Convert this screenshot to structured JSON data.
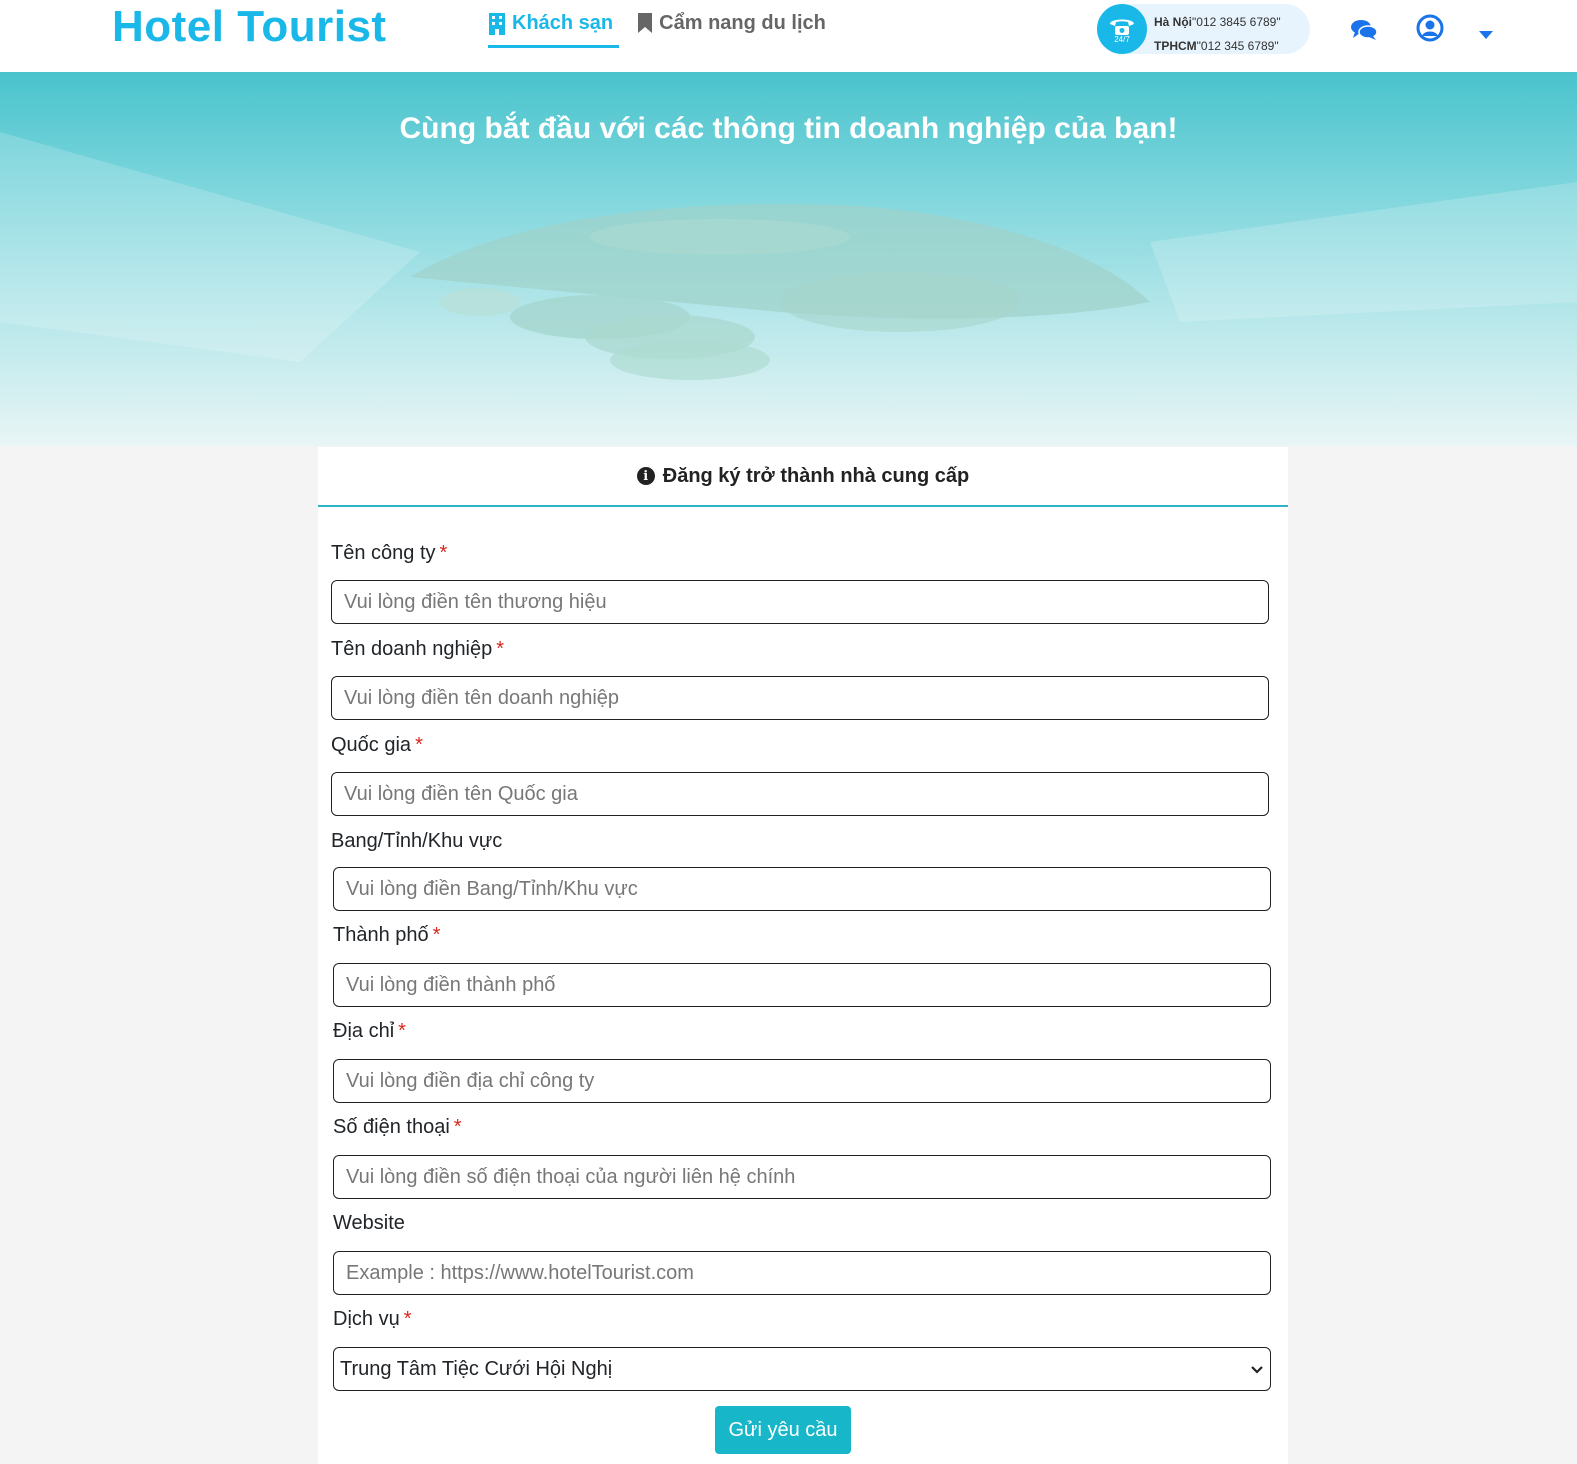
{
  "header": {
    "logo": "Hotel Tourist",
    "nav": [
      {
        "label": "Khách sạn",
        "icon": "building-icon",
        "active": true
      },
      {
        "label": "Cẩm nang du lịch",
        "icon": "bookmark-icon",
        "active": false
      }
    ],
    "hotline": {
      "badge": "24/7",
      "lines": [
        {
          "city": "Hà Nội",
          "number": "\"012 3845 6789\""
        },
        {
          "city": "TPHCM",
          "number": "\"012 345 6789\""
        }
      ]
    },
    "icons": [
      "chat-icon",
      "user-icon",
      "caret-down-icon"
    ]
  },
  "banner": {
    "title": "Cùng bắt đầu với các thông tin doanh nghiệp của bạn!"
  },
  "form": {
    "title": "Đăng ký trở thành nhà cung cấp",
    "required_mark": "*",
    "fields": [
      {
        "label": "Tên công ty",
        "required": true,
        "placeholder": "Vui lòng điền tên thương hiệu"
      },
      {
        "label": "Tên doanh nghiệp",
        "required": true,
        "placeholder": "Vui lòng điền tên doanh nghiệp"
      },
      {
        "label": "Quốc gia",
        "required": true,
        "placeholder": "Vui lòng điền tên Quốc gia"
      },
      {
        "label": "Bang/Tỉnh/Khu vực",
        "required": false,
        "placeholder": "Vui lòng điền Bang/Tỉnh/Khu vực"
      },
      {
        "label": "Thành phố",
        "required": true,
        "placeholder": "Vui lòng điền thành phố"
      },
      {
        "label": "Địa chỉ",
        "required": true,
        "placeholder": "Vui lòng điền địa chỉ công ty"
      },
      {
        "label": "Số điện thoại",
        "required": true,
        "placeholder": "Vui lòng điền số điện thoại của người liên hệ chính"
      },
      {
        "label": "Website",
        "required": false,
        "placeholder": "Example : https://www.hotelTourist.com"
      }
    ],
    "service": {
      "label": "Dịch vụ",
      "required": true,
      "selected": "Trung Tâm Tiệc Cưới Hội Nghị"
    },
    "submit_label": "Gửi yêu cầu"
  },
  "colors": {
    "brand": "#1ab8e8",
    "teal": "#17b7c9",
    "required": "#d9261c"
  }
}
